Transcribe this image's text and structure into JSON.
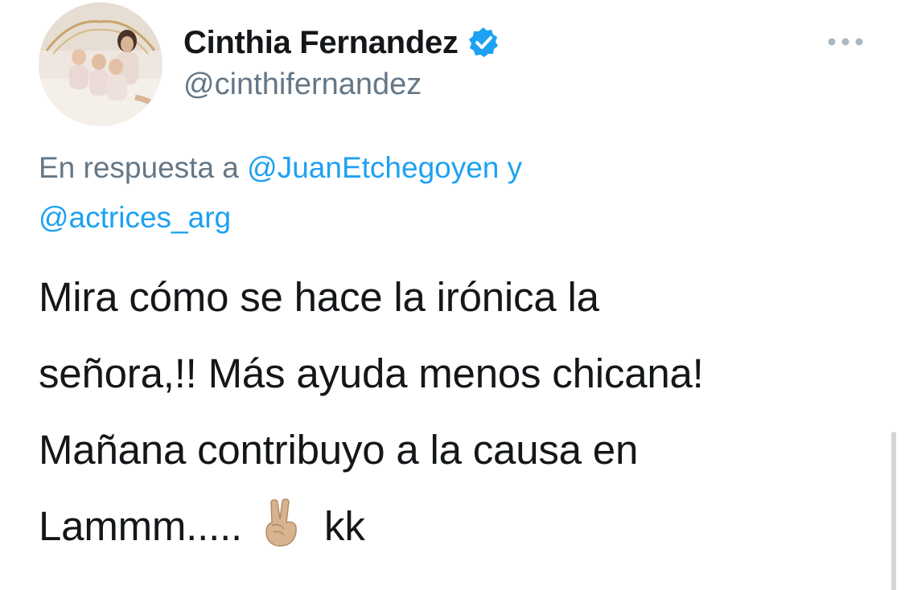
{
  "user": {
    "display_name": "Cinthia Fernandez",
    "handle": "@cinthifernandez",
    "verified": true,
    "verified_icon": "verified-badge-icon",
    "avatar_icon": "profile-photo"
  },
  "reply": {
    "prefix": "En respuesta a",
    "mention_1": "@JuanEtchegoyen",
    "conjunction": "y",
    "mention_2": "@actrices_arg"
  },
  "tweet": {
    "line_1": "Mira cómo se hace la irónica la",
    "line_2": "señora,!! Más ayuda menos chicana!",
    "line_3": "Mañana contribuyo a la causa en",
    "line_4_start": "Lammm.....",
    "emoji": "victory-hand-emoji",
    "line_4_end": "kk"
  },
  "menu": {
    "icon": "more-options-icon"
  },
  "colors": {
    "link": "#1da1f2",
    "muted": "#657786",
    "text": "#14171a",
    "verified": "#1da1f2"
  }
}
